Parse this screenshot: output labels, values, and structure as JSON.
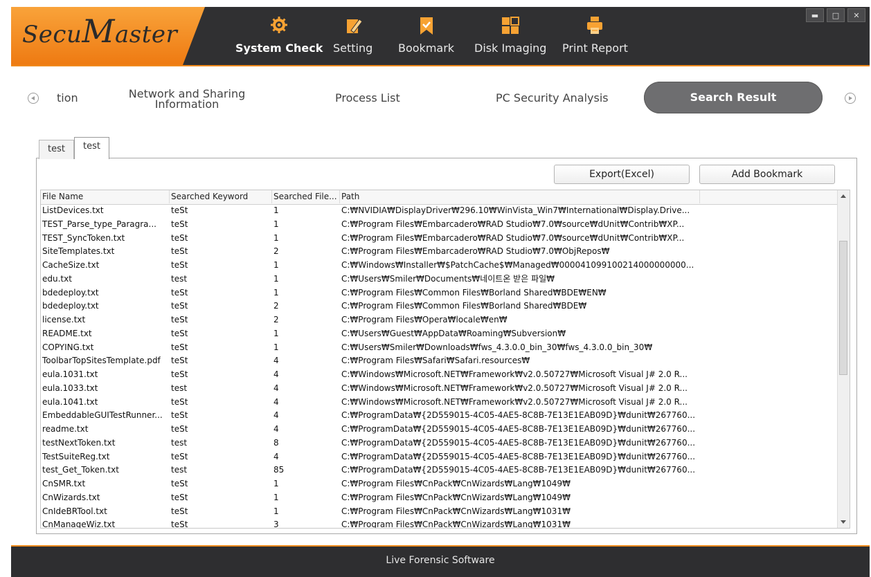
{
  "app": {
    "logo_text": "SecuMaster",
    "logo_part1": "Secu",
    "logo_part2": "M",
    "logo_part3": "aster",
    "window_controls": [
      "minimize-icon",
      "maximize-icon",
      "close-icon"
    ]
  },
  "nav": {
    "items": [
      {
        "label": "System Check",
        "icon": "gear-icon",
        "active": true
      },
      {
        "label": "Setting",
        "icon": "pencil-icon",
        "active": false
      },
      {
        "label": "Bookmark",
        "icon": "bookmark-icon",
        "active": false
      },
      {
        "label": "Disk Imaging",
        "icon": "disk-image-icon",
        "active": false
      },
      {
        "label": "Print Report",
        "icon": "printer-icon",
        "active": false
      }
    ]
  },
  "section_tabs": {
    "items": [
      "tion",
      "Network and Sharing\nInformation",
      "Process List",
      "PC Security Analysis",
      "Search Result"
    ],
    "item_line1": "Network and Sharing",
    "item_line2": "Information",
    "active": "Search Result"
  },
  "sub_tabs": [
    "test",
    "test"
  ],
  "toolbar": {
    "export_label": "Export(Excel)",
    "bookmark_label": "Add Bookmark"
  },
  "table": {
    "columns": [
      "File Name",
      "Searched Keyword",
      "Searched File...",
      "Path"
    ],
    "rows": [
      [
        "ListDevices.txt",
        "teSt",
        "1",
        "C:₩NVIDIA₩DisplayDriver₩296.10₩WinVista_Win7₩International₩Display.Drive..."
      ],
      [
        "TEST_Parse_type_Paragra...",
        "teSt",
        "1",
        "C:₩Program Files₩Embarcadero₩RAD Studio₩7.0₩source₩dUnit₩Contrib₩XP..."
      ],
      [
        "TEST_SyncToken.txt",
        "teSt",
        "1",
        "C:₩Program Files₩Embarcadero₩RAD Studio₩7.0₩source₩dUnit₩Contrib₩XP..."
      ],
      [
        "SiteTemplates.txt",
        "teSt",
        "2",
        "C:₩Program Files₩Embarcadero₩RAD Studio₩7.0₩ObjRepos₩"
      ],
      [
        "CacheSize.txt",
        "teSt",
        "1",
        "C:₩Windows₩Installer₩$PatchCache$₩Managed₩000041099100214000000000..."
      ],
      [
        "edu.txt",
        "test",
        "1",
        "C:₩Users₩Smiler₩Documents₩네이트온 받은 파일₩"
      ],
      [
        "bdedeploy.txt",
        "teSt",
        "1",
        "C:₩Program Files₩Common Files₩Borland Shared₩BDE₩EN₩"
      ],
      [
        "bdedeploy.txt",
        "teSt",
        "2",
        "C:₩Program Files₩Common Files₩Borland Shared₩BDE₩"
      ],
      [
        "license.txt",
        "teSt",
        "2",
        "C:₩Program Files₩Opera₩locale₩en₩"
      ],
      [
        "README.txt",
        "teSt",
        "1",
        "C:₩Users₩Guest₩AppData₩Roaming₩Subversion₩"
      ],
      [
        "COPYING.txt",
        "teSt",
        "1",
        "C:₩Users₩Smiler₩Downloads₩fws_4.3.0.0_bin_30₩fws_4.3.0.0_bin_30₩"
      ],
      [
        "ToolbarTopSitesTemplate.pdf",
        "teSt",
        "4",
        "C:₩Program Files₩Safari₩Safari.resources₩"
      ],
      [
        "eula.1031.txt",
        "teSt",
        "4",
        "C:₩Windows₩Microsoft.NET₩Framework₩v2.0.50727₩Microsoft Visual J# 2.0 R..."
      ],
      [
        "eula.1033.txt",
        "test",
        "4",
        "C:₩Windows₩Microsoft.NET₩Framework₩v2.0.50727₩Microsoft Visual J# 2.0 R..."
      ],
      [
        "eula.1041.txt",
        "teSt",
        "4",
        "C:₩Windows₩Microsoft.NET₩Framework₩v2.0.50727₩Microsoft Visual J# 2.0 R..."
      ],
      [
        "EmbeddableGUITestRunner...",
        "teSt",
        "4",
        "C:₩ProgramData₩{2D559015-4C05-4AE5-8C8B-7E13E1EAB09D}₩dunit₩267760..."
      ],
      [
        "readme.txt",
        "teSt",
        "4",
        "C:₩ProgramData₩{2D559015-4C05-4AE5-8C8B-7E13E1EAB09D}₩dunit₩267760..."
      ],
      [
        "testNextToken.txt",
        "test",
        "8",
        "C:₩ProgramData₩{2D559015-4C05-4AE5-8C8B-7E13E1EAB09D}₩dunit₩267760..."
      ],
      [
        "TestSuiteReg.txt",
        "teSt",
        "4",
        "C:₩ProgramData₩{2D559015-4C05-4AE5-8C8B-7E13E1EAB09D}₩dunit₩267760..."
      ],
      [
        "test_Get_Token.txt",
        "test",
        "85",
        "C:₩ProgramData₩{2D559015-4C05-4AE5-8C8B-7E13E1EAB09D}₩dunit₩267760..."
      ],
      [
        "CnSMR.txt",
        "teSt",
        "1",
        "C:₩Program Files₩CnPack₩CnWizards₩Lang₩1049₩"
      ],
      [
        "CnWizards.txt",
        "teSt",
        "1",
        "C:₩Program Files₩CnPack₩CnWizards₩Lang₩1049₩"
      ],
      [
        "CnIdeBRTool.txt",
        "teSt",
        "1",
        "C:₩Program Files₩CnPack₩CnWizards₩Lang₩1031₩"
      ],
      [
        "CnManageWiz.txt",
        "teSt",
        "3",
        "C:₩Program Files₩CnPack₩CnWizards₩Lang₩1031₩"
      ]
    ]
  },
  "footer": {
    "text": "Live Forensic Software"
  },
  "colors": {
    "accent": "#f08a1c",
    "header_bg": "#303032",
    "active_tab": "#6e6e70"
  }
}
